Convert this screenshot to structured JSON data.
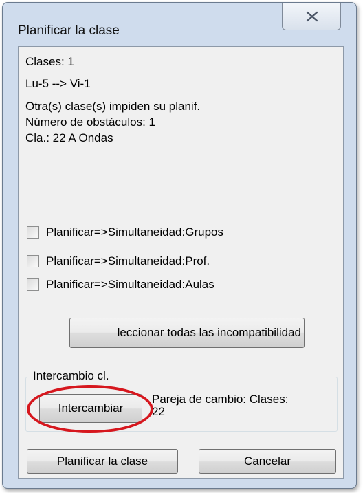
{
  "window": {
    "title": "Planificar la clase"
  },
  "info": {
    "classes": "Clases: 1",
    "move": "Lu-5 --> Vi-1",
    "reason": "Otra(s) clase(s) impiden su planif.",
    "obstacles": "Número de obstáculos: 1",
    "class_ref": "Cla.: 22 A Ondas"
  },
  "options": [
    {
      "label": "Planificar=>Simultaneidad:Grupos",
      "checked": false
    },
    {
      "label": "Planificar=>Simultaneidad:Prof.",
      "checked": false
    },
    {
      "label": "Planificar=>Simultaneidad:Aulas",
      "checked": false
    }
  ],
  "select_all_button": "leccionar todas las incompatibilidad",
  "exchange_group": {
    "legend": "Intercambio cl.",
    "button": "Intercambiar",
    "pair_line1": "Pareja de cambio: Clases:",
    "pair_line2": "22",
    "highlight_color": "#d6171e"
  },
  "footer": {
    "plan_button": "Planificar la clase",
    "cancel_button": "Cancelar"
  }
}
